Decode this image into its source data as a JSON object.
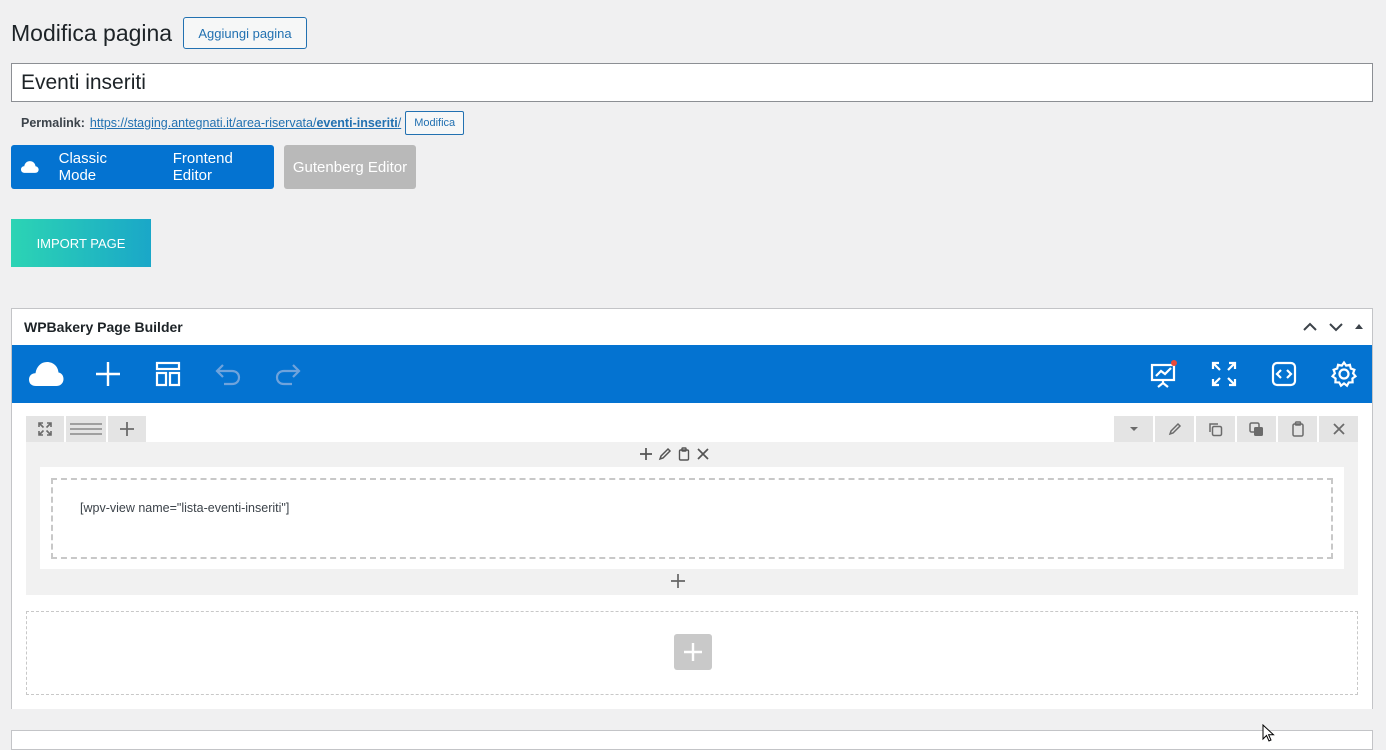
{
  "header": {
    "title": "Modifica pagina",
    "add_page_label": "Aggiungi pagina"
  },
  "post": {
    "title_value": "Eventi inseriti"
  },
  "permalink": {
    "label": "Permalink:",
    "url_base": "https://staging.antegnati.it/area-riservata/",
    "slug": "eventi-inseriti",
    "url_tail": "/",
    "edit_label": "Modifica"
  },
  "editor_modes": {
    "classic": "Classic Mode",
    "frontend": "Frontend Editor",
    "gutenberg": "Gutenberg Editor"
  },
  "import_label": "IMPORT PAGE",
  "builder": {
    "title": "WPBakery Page Builder",
    "toolbar_left": [
      "cloud-logo-icon",
      "add-element-icon",
      "templates-icon",
      "undo-icon",
      "redo-icon"
    ],
    "toolbar_right": [
      "seo-chart-icon",
      "fullscreen-icon",
      "custom-code-icon",
      "settings-icon"
    ],
    "element_shortcode": "[wpv-view name=\"lista-eventi-inseriti\"]"
  },
  "colors": {
    "accent": "#0473d1",
    "link": "#2271b1",
    "notification_dot": "#e94b3c",
    "import_gradient_start": "#2cd4b4",
    "import_gradient_end": "#1aa7c8"
  }
}
